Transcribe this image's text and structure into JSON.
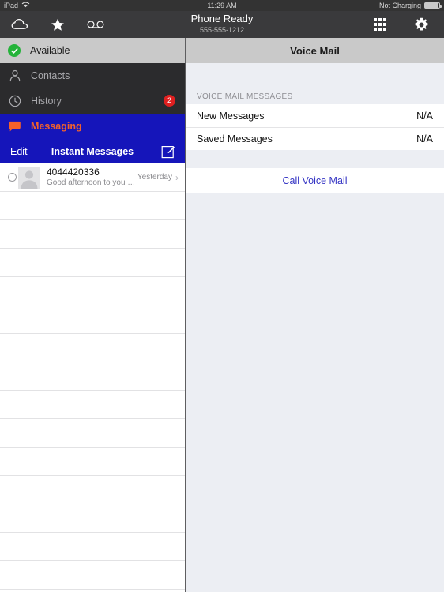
{
  "status_bar": {
    "device": "iPad",
    "wifi_icon": "wifi-icon",
    "time": "11:29 AM",
    "battery_text": "Not Charging",
    "battery_icon": "battery-icon"
  },
  "app_toolbar": {
    "icons": [
      {
        "name": "cloud-icon",
        "label": "Cloud"
      },
      {
        "name": "star-icon",
        "label": "Favorites"
      },
      {
        "name": "voicemail-icon",
        "label": "Voicemail"
      }
    ],
    "title": "Phone Ready",
    "subtitle": "555-555-1212",
    "right_icons": [
      {
        "name": "keypad-grid-icon",
        "label": "Keypad"
      },
      {
        "name": "gear-icon",
        "label": "Settings"
      }
    ]
  },
  "sidebar": {
    "status": {
      "label": "Available",
      "icon": "check-circle-icon",
      "color": "#24b33a"
    },
    "nav_items": [
      {
        "label": "Contacts",
        "icon": "person-icon",
        "badge": "",
        "active": false
      },
      {
        "label": "History",
        "icon": "clock-icon",
        "badge": "2",
        "active": false
      },
      {
        "label": "Messaging",
        "icon": "chat-bubble-icon",
        "badge": "",
        "active": true
      }
    ],
    "sub_toolbar": {
      "edit_label": "Edit",
      "title": "Instant Messages",
      "compose_icon": "compose-icon"
    },
    "messages": [
      {
        "name": "4044420336",
        "preview": "Good afternoon to you as well",
        "time": "Yesterday",
        "unread": true
      }
    ],
    "empty_row_count": 14
  },
  "detail": {
    "nav_title": "Voice Mail",
    "section_header": "VOICE MAIL MESSAGES",
    "rows": [
      {
        "label": "New Messages",
        "value": "N/A"
      },
      {
        "label": "Saved Messages",
        "value": "N/A"
      }
    ],
    "action_label": "Call Voice Mail"
  },
  "colors": {
    "accent_blue": "#1515ba",
    "accent_orange": "#f4622a",
    "link_blue": "#3434c4",
    "badge_red": "#e02020",
    "available_green": "#24b33a",
    "toolbar_dark": "#3a3a3c",
    "nav_dark": "#2b2b2d",
    "panel_gray": "#eceef3"
  }
}
